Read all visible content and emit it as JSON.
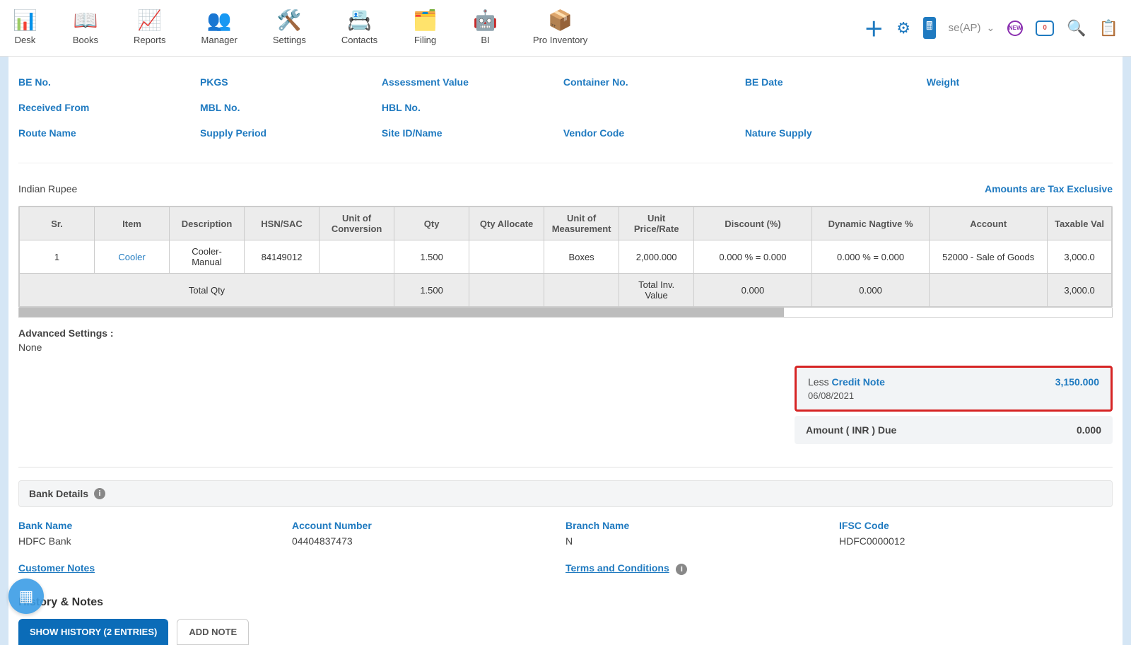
{
  "nav": [
    {
      "label": "Desk"
    },
    {
      "label": "Books"
    },
    {
      "label": "Reports"
    },
    {
      "label": "Manager"
    },
    {
      "label": "Settings"
    },
    {
      "label": "Contacts"
    },
    {
      "label": "Filing"
    },
    {
      "label": "BI"
    },
    {
      "label": "Pro Inventory"
    }
  ],
  "user_label": "se(AP)",
  "notif_count": "0",
  "fields": {
    "r1": [
      "BE No.",
      "PKGS",
      "Assessment Value",
      "Container No.",
      "BE Date",
      "Weight"
    ],
    "r2": [
      "Received From",
      "MBL No.",
      "HBL No."
    ],
    "r3": [
      "Route Name",
      "Supply Period",
      "Site ID/Name",
      "Vendor Code",
      "Nature Supply"
    ]
  },
  "currency_label": "Indian Rupee",
  "tax_exclusive_label": "Amounts are Tax Exclusive",
  "columns": [
    "Sr.",
    "Item",
    "Description",
    "HSN/SAC",
    "Unit of Conversion",
    "Qty",
    "Qty Allocate",
    "Unit of Measurement",
    "Unit Price/Rate",
    "Discount (%)",
    "Dynamic Nagtive %",
    "Account",
    "Taxable Val"
  ],
  "row": {
    "sr": "1",
    "item": "Cooler",
    "desc": "Cooler- Manual",
    "hsn": "84149012",
    "uoc": "",
    "qty": "1.500",
    "qtya": "",
    "uom": "Boxes",
    "price": "2,000.000",
    "disc": "0.000 % = 0.000",
    "dyn": "0.000 % = 0.000",
    "acct": "52000 - Sale of Goods",
    "taxable": "3,000.0"
  },
  "totals": {
    "label": "Total Qty",
    "qty": "1.500",
    "inv_label": "Total Inv. Value",
    "disc": "0.000",
    "dyn": "0.000",
    "taxable": "3,000.0"
  },
  "adv_settings_label": "Advanced Settings :",
  "adv_settings_value": "None",
  "credit_note": {
    "less": "Less",
    "link": "Credit Note",
    "date": "06/08/2021",
    "amount": "3,150.000"
  },
  "due": {
    "label": "Amount ( INR ) Due",
    "amount": "0.000"
  },
  "bank_header": "Bank Details",
  "bank": {
    "name_label": "Bank Name",
    "name_value": "HDFC Bank",
    "acct_label": "Account Number",
    "acct_value": "04404837473",
    "branch_label": "Branch Name",
    "branch_value": "N",
    "ifsc_label": "IFSC Code",
    "ifsc_value": "HDFC0000012"
  },
  "customer_notes_link": "Customer Notes",
  "terms_link": "Terms and Conditions",
  "history_title": "History & Notes",
  "show_history_btn": "SHOW HISTORY (2 ENTRIES)",
  "add_note_btn": "ADD NOTE"
}
